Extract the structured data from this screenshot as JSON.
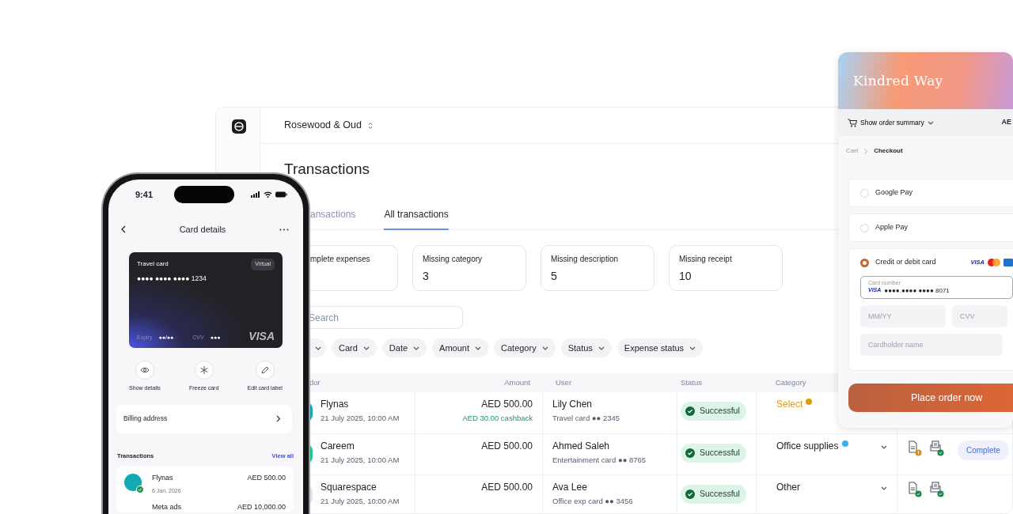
{
  "dashboard": {
    "company": "Rosewood & Oud",
    "title": "Transactions",
    "tabs": [
      {
        "label": "ansactions",
        "selected": false
      },
      {
        "label": "All transactions",
        "selected": true
      }
    ],
    "stats": [
      {
        "label": "mplete expenses"
      },
      {
        "label": "Missing category",
        "value": "3"
      },
      {
        "label": "Missing description",
        "value": "5"
      },
      {
        "label": "Missing receipt",
        "value": "10"
      }
    ],
    "search": {
      "placeholder": "Search"
    },
    "filters": [
      "Card",
      "Date",
      "Amount",
      "Category",
      "Status",
      "Expense status"
    ],
    "table": {
      "columns": [
        "dor",
        "Amount",
        "User",
        "Status",
        "Category"
      ],
      "rows": [
        {
          "color": "#1aa7b8",
          "vendor": "Flynas",
          "date": "21 July 2025, 10:00 AM",
          "amount": "AED 500.00",
          "cashback": "AED 30.00 cashback",
          "user": "Lily Chen",
          "card": "Travel card ●● 2345",
          "status": "Successful",
          "category": {
            "kind": "select",
            "label": "Select",
            "color": "#e39a0b"
          }
        },
        {
          "color": "#1ec98b",
          "vendor": "Careem",
          "date": "21 July 2025, 10:00 AM",
          "amount": "AED 500.00",
          "user": "Ahmed Saleh",
          "card": "Entertainment card ●● 8765",
          "status": "Successful",
          "category": {
            "kind": "value",
            "label": "Office supplies",
            "color": "#3aaef5"
          },
          "document_complete": false,
          "receipt_complete": true,
          "expense_status": "Complete"
        },
        {
          "color": "#e3e3ea",
          "vendor": "Squarespace",
          "date": "21 July 2025, 10:00 AM",
          "amount": "AED 500.00",
          "user": "Ava Lee",
          "card": "Office exp card ●● 3456",
          "status": "Successful",
          "category": {
            "kind": "value",
            "label": "Other"
          },
          "document_complete": true,
          "receipt_complete": true
        }
      ]
    }
  },
  "phone": {
    "time": "9:41",
    "title": "Card details",
    "card": {
      "name": "Travel card",
      "badge": "Virtual",
      "number": "●●●● ●●●● ●●●● 1234",
      "expiry_label": "Expiry",
      "expiry": "●●/●●",
      "cvv_label": "CVV",
      "cvv": "●●●",
      "brand": "VISA"
    },
    "actions": [
      {
        "kind": "eye",
        "label": "Show details"
      },
      {
        "kind": "freeze",
        "label": "Freeze card"
      },
      {
        "kind": "edit",
        "label": "Edit card label"
      }
    ],
    "billing": "Billing address",
    "transactions_title": "Transactions",
    "view_all": "View all",
    "transactions": [
      {
        "name": "Flynas",
        "date": "6 Jan, 2026",
        "amount": "AED 500.00",
        "color": "#13a9b5"
      },
      {
        "name": "Meta ads",
        "amount": "AED 10,000.00"
      }
    ]
  },
  "checkout": {
    "brand": "Kindred Way",
    "summary": "Show order summary",
    "total": "AE",
    "breadcrumb": [
      "Cart",
      "Checkout"
    ],
    "methods": [
      {
        "label": "Google Pay",
        "selected": false
      },
      {
        "label": "Apple Pay",
        "selected": false
      },
      {
        "label": "Credit or debit card",
        "selected": true,
        "logo_text": "VISA"
      }
    ],
    "card_number_label": "Card number",
    "card_number_brand": "VISA",
    "card_number": "●●●●.●●●● ●●●● 8071",
    "expiry_placeholder": "MM/YY",
    "cvv_placeholder": "CVV",
    "name_placeholder": "Cardholder name",
    "button": "Place order now"
  }
}
